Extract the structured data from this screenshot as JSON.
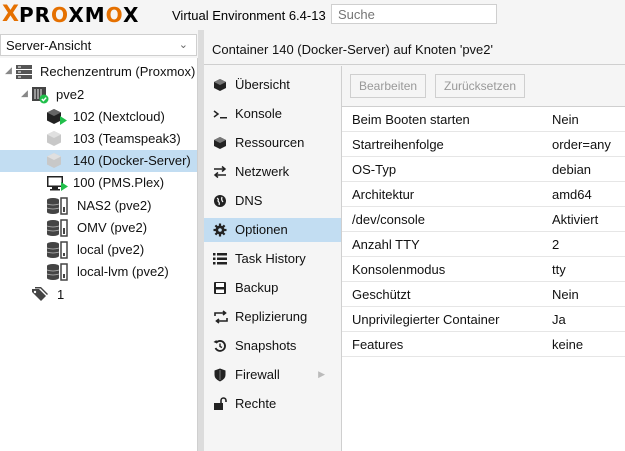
{
  "app": {
    "logo_x": "X",
    "logo_text_1": "PR",
    "logo_text_o1": "O",
    "logo_text_2": "XM",
    "logo_text_o2": "O",
    "logo_text_3": "X",
    "version": "Virtual Environment 6.4-13",
    "search_placeholder": "Suche"
  },
  "sidebar": {
    "view_select": "Server-Ansicht",
    "tree": [
      {
        "label": "Rechenzentrum (Proxmox)",
        "icon": "datacenter-icon"
      },
      {
        "label": "pve2",
        "icon": "node-online-icon"
      },
      {
        "label": "102 (Nextcloud)",
        "icon": "container-running-icon"
      },
      {
        "label": "103 (Teamspeak3)",
        "icon": "container-stopped-icon"
      },
      {
        "label": "140 (Docker-Server)",
        "icon": "container-stopped-icon",
        "selected": true
      },
      {
        "label": "100 (PMS.Plex)",
        "icon": "vm-running-icon"
      },
      {
        "label": "NAS2 (pve2)",
        "icon": "storage-icon"
      },
      {
        "label": "OMV (pve2)",
        "icon": "storage-icon"
      },
      {
        "label": "local (pve2)",
        "icon": "storage-icon"
      },
      {
        "label": "local-lvm (pve2)",
        "icon": "storage-icon"
      },
      {
        "label": "1",
        "icon": "tags-icon"
      }
    ]
  },
  "main": {
    "title": "Container 140 (Docker-Server) auf Knoten 'pve2'",
    "nav": [
      {
        "label": "Übersicht",
        "icon": "summary-icon"
      },
      {
        "label": "Konsole",
        "icon": "console-icon"
      },
      {
        "label": "Ressourcen",
        "icon": "resources-icon"
      },
      {
        "label": "Netzwerk",
        "icon": "network-icon"
      },
      {
        "label": "DNS",
        "icon": "dns-icon"
      },
      {
        "label": "Optionen",
        "icon": "options-icon",
        "active": true
      },
      {
        "label": "Task History",
        "icon": "task-history-icon"
      },
      {
        "label": "Backup",
        "icon": "backup-icon"
      },
      {
        "label": "Replizierung",
        "icon": "replication-icon"
      },
      {
        "label": "Snapshots",
        "icon": "snapshots-icon"
      },
      {
        "label": "Firewall",
        "icon": "firewall-icon",
        "has_submenu": true
      },
      {
        "label": "Rechte",
        "icon": "permissions-icon"
      }
    ],
    "toolbar": {
      "edit_label": "Bearbeiten",
      "reset_label": "Zurücksetzen"
    },
    "options": [
      {
        "key": "Beim Booten starten",
        "value": "Nein"
      },
      {
        "key": "Startreihenfolge",
        "value": "order=any"
      },
      {
        "key": "OS-Typ",
        "value": "debian"
      },
      {
        "key": "Architektur",
        "value": "amd64"
      },
      {
        "key": "/dev/console",
        "value": "Aktiviert"
      },
      {
        "key": "Anzahl TTY",
        "value": "2"
      },
      {
        "key": "Konsolenmodus",
        "value": "tty"
      },
      {
        "key": "Geschützt",
        "value": "Nein"
      },
      {
        "key": "Unprivilegierter Container",
        "value": "Ja"
      },
      {
        "key": "Features",
        "value": "keine"
      }
    ]
  },
  "colors": {
    "accent": "#e57000",
    "selection": "#c2ddf2",
    "running": "#21bf4b"
  }
}
